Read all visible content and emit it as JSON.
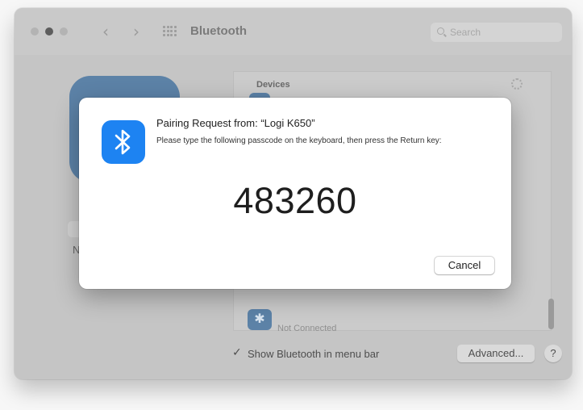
{
  "window": {
    "title": "Bluetooth",
    "search_placeholder": "Search",
    "nav_back_glyph": "‹",
    "nav_forward_glyph": "›"
  },
  "left_panel": {
    "label": "N"
  },
  "devices": {
    "header": "Devices",
    "last_device_status": "Not Connected"
  },
  "footer": {
    "show_in_menu_bar_checked": true,
    "show_in_menu_bar_label": "Show Bluetooth in menu bar",
    "checkmark_glyph": "✓",
    "advanced_label": "Advanced...",
    "help_label": "?"
  },
  "dialog": {
    "title": "Pairing Request from: “Logi K650”",
    "message": "Please type the following passcode on the keyboard, then press the Return key:",
    "passcode": "483260",
    "cancel_label": "Cancel"
  },
  "colors": {
    "bluetooth_blue": "#1d83f2",
    "dimmed_window": "#c5c5c5",
    "dialog_background": "#ffffff"
  },
  "icons": [
    "bluetooth-icon",
    "search-icon",
    "grid-icon",
    "chevron-left-icon",
    "chevron-right-icon",
    "spinner-icon"
  ]
}
